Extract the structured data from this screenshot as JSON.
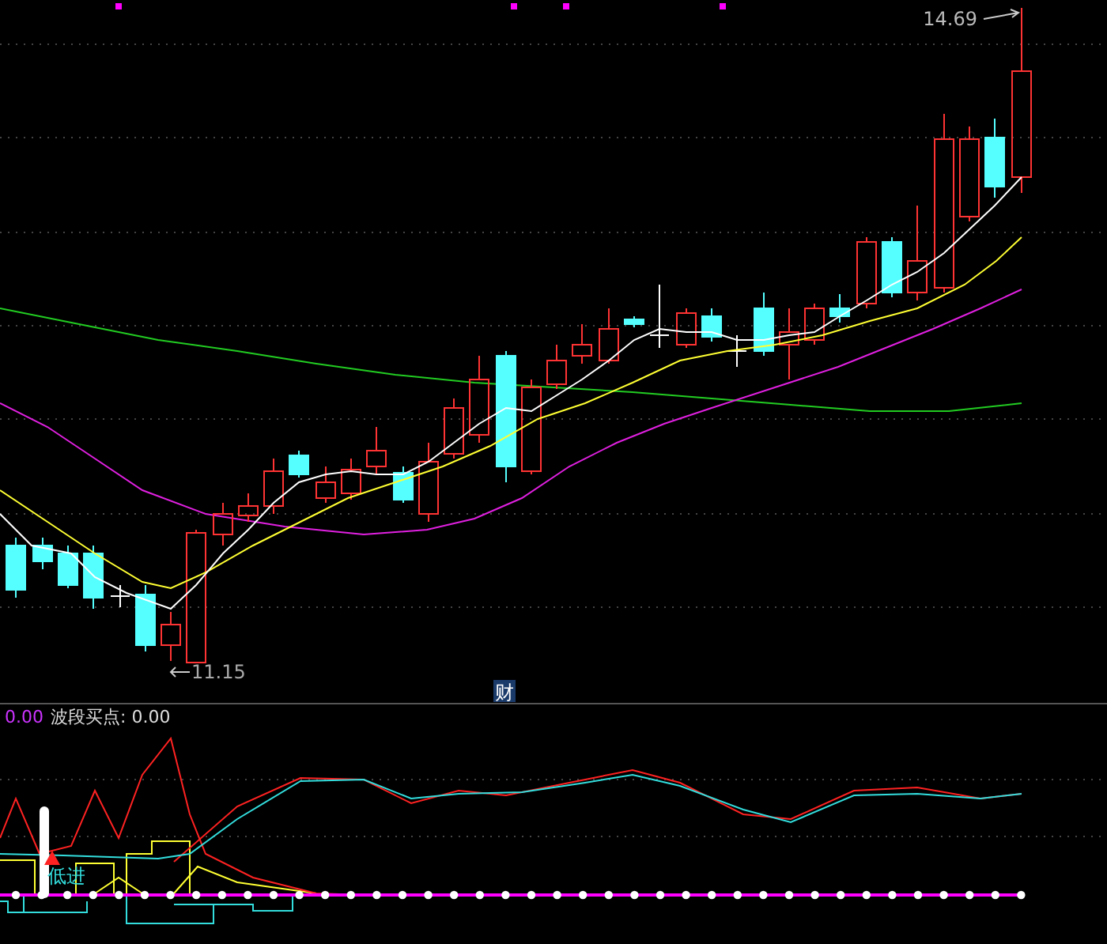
{
  "price_chart": {
    "high_label": "14.69",
    "low_label": "11.15",
    "marker": "财"
  },
  "indicator": {
    "value": "0.00",
    "title": "波段买点: 0.00",
    "signal_label": "低进"
  }
}
